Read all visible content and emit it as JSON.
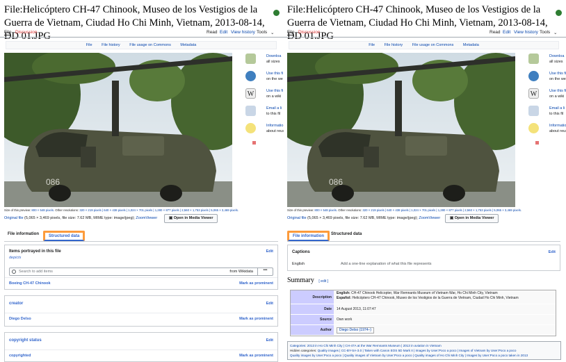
{
  "page_title": "File:Helicóptero CH-47 Chinook, Museo de los Vestigios de la Guerra de Vietnam, Ciudad Ho Chi Minh, Vietnam, 2013-08-14, DD 01.JPG",
  "tabs": {
    "file": "File",
    "discussion": "Discussion",
    "read": "Read",
    "edit": "Edit",
    "view_history": "View history",
    "tools": "Tools",
    "tools_chevron": "⌄"
  },
  "subnav": {
    "file": "File",
    "history": "File history",
    "usage": "File usage on Commons",
    "metadata": "Metadata"
  },
  "sidebar": [
    {
      "icon": "download-icon",
      "line1": "Downloa",
      "line2": "all sizes"
    },
    {
      "icon": "globe-icon",
      "line1": "Use this fi",
      "line2": "on the we"
    },
    {
      "icon": "wikipedia-icon",
      "glyph": "W",
      "line1": "Use this fi",
      "line2": "on a wiki"
    },
    {
      "icon": "email-icon",
      "line1": "Email a li",
      "line2": "to this fil"
    },
    {
      "icon": "lightbulb-icon",
      "line1": "Informatio",
      "line2": "about reus"
    }
  ],
  "preview": {
    "size_label": "Size of this preview:",
    "size_value": "800 × 548 pixels.",
    "other_label": "Other resolutions:",
    "resolutions": "320 × 219 pixels | 640 × 438 pixels | 1,024 × 701 pixels | 1,280 × 877 pixels | 2,560 × 1,753 pixels | 5,065 × 3,469 pixels."
  },
  "original": {
    "link": "Original file",
    "info": "(5,065 × 3,469 pixels, file size: 7.62 MB, MIME type: image/jpeg);",
    "zoom": "ZoomViewer",
    "button": "Open in Media Viewer"
  },
  "filetabs": {
    "info": "File information",
    "structured": "Structured data"
  },
  "left": {
    "items_portrayed": {
      "title": "Items portrayed in this file",
      "sub": "depicts",
      "edit": "Edit",
      "search_placeholder": "Search to add items",
      "search_source": "from Wikidata",
      "more": "•••",
      "value": "Boeing CH-47 Chinook",
      "prominent": "Mark as prominent"
    },
    "creator": {
      "title": "creator",
      "edit": "Edit",
      "value": "Diego Delso",
      "prominent": "Mark as prominent"
    },
    "copyright": {
      "title": "copyright status",
      "edit": "Edit",
      "value": "copyrighted",
      "prominent": "Mark as prominent"
    }
  },
  "right": {
    "captions": {
      "title": "Captions",
      "edit": "Edit",
      "lang": "English",
      "placeholder": "Add a one-line explanation of what this file represents"
    },
    "summary": {
      "title": "Summary",
      "edit": "[ edit ]",
      "desc_label": "Description",
      "desc_en_lang": "English:",
      "desc_en": "CH-47 Chinook Helicopter, War Remnants Museum of Vietnam War, Ho Chi Minh City, Vietnam",
      "desc_es_lang": "Español:",
      "desc_es": "Helicóptero CH-47 Chinook, Museo de los Vestigios de la Guerra de Vietnam, Ciudad Ho Chi Minh, Vietnam",
      "date_label": "Date",
      "date": "14 August 2013, 11:07:47",
      "source_label": "Source",
      "source": "Own work",
      "author_label": "Author",
      "author": "Diego Delso (1974–)"
    },
    "categories": {
      "label": "Categories:",
      "line1": "2013 in Ho Chi Minh City | CH-47A at the War Remnants Museum | 2013 in aviation in Vietnam",
      "hidden_label": "Hidden categories:",
      "line2": "Quality images | CC-BY-SA-3.0 | Taken with Canon EOS 5D Mark II | Images by User:Poco a poco | Images of Vietnam by User:Poco a poco",
      "line3": "Quality images by User:Poco a poco | Quality images of Vietnam by User:Poco a poco | Quality images of Ho Chi Minh City | Images by User:Poco a poco taken in 2013"
    }
  }
}
